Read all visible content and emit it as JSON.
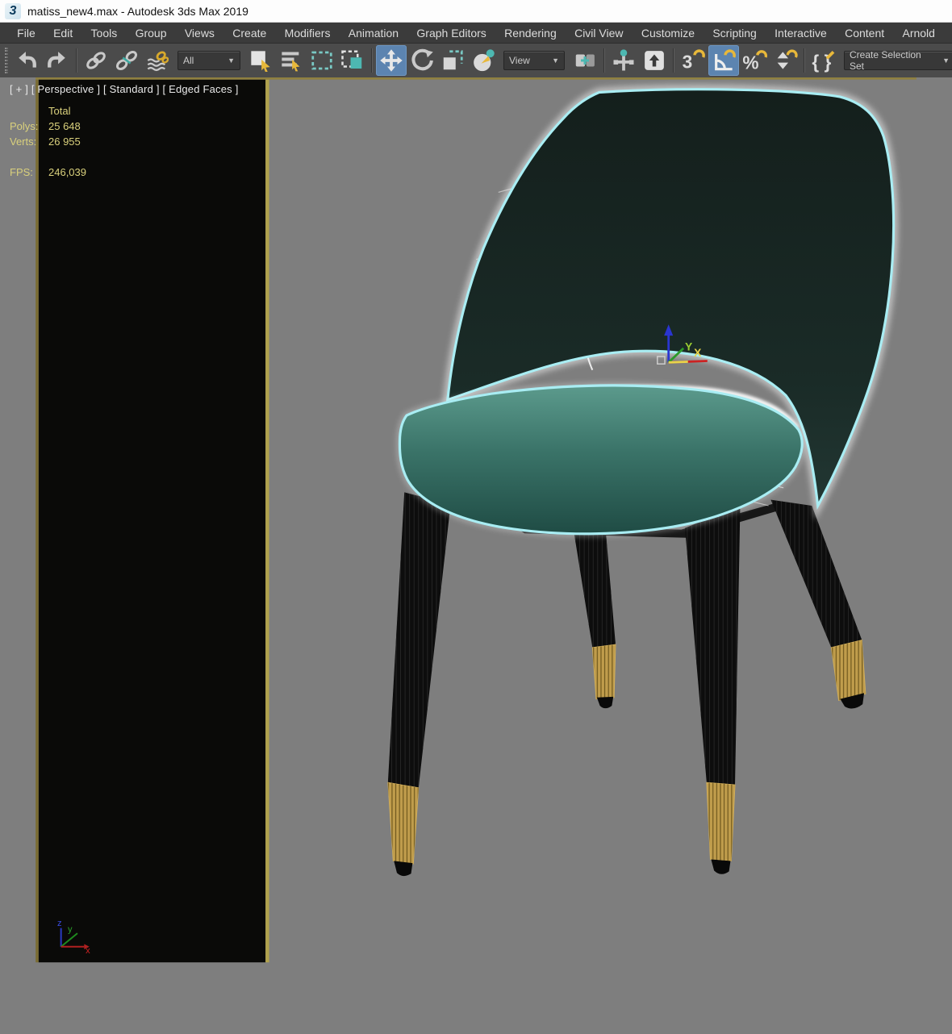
{
  "window": {
    "title": "matiss_new4.max - Autodesk 3ds Max 2019",
    "app_icon_glyph": "3"
  },
  "menu": {
    "items": [
      {
        "label": "File"
      },
      {
        "label": "Edit"
      },
      {
        "label": "Tools"
      },
      {
        "label": "Group"
      },
      {
        "label": "Views"
      },
      {
        "label": "Create"
      },
      {
        "label": "Modifiers"
      },
      {
        "label": "Animation"
      },
      {
        "label": "Graph Editors"
      },
      {
        "label": "Rendering"
      },
      {
        "label": "Civil View"
      },
      {
        "label": "Customize"
      },
      {
        "label": "Scripting"
      },
      {
        "label": "Interactive"
      },
      {
        "label": "Content"
      },
      {
        "label": "Arnold"
      }
    ]
  },
  "toolbar": {
    "selection_filter_value": "All",
    "coord_system_value": "View",
    "selection_set_placeholder": "Create Selection Set",
    "dropdown_arrow": "▼",
    "active_buttons": [
      "select-and-move",
      "angle-snap-toggle"
    ],
    "buttons": [
      {
        "name": "undo"
      },
      {
        "name": "redo"
      },
      {
        "name": "select-and-link"
      },
      {
        "name": "unlink-selection"
      },
      {
        "name": "bind-to-space-warp"
      },
      {
        "name": "selection-filter-dropdown"
      },
      {
        "name": "select-object"
      },
      {
        "name": "select-by-name"
      },
      {
        "name": "rectangular-selection-region"
      },
      {
        "name": "window-crossing-toggle"
      },
      {
        "name": "select-and-move"
      },
      {
        "name": "select-and-rotate"
      },
      {
        "name": "select-and-uniform-scale"
      },
      {
        "name": "select-and-place"
      },
      {
        "name": "reference-coordinate-system"
      },
      {
        "name": "use-pivot-point-center"
      },
      {
        "name": "select-and-manipulate"
      },
      {
        "name": "keyboard-shortcut-override-toggle"
      },
      {
        "name": "snaps-toggle-3d"
      },
      {
        "name": "angle-snap-toggle"
      },
      {
        "name": "percent-snap-toggle"
      },
      {
        "name": "spinner-snap-toggle"
      },
      {
        "name": "edit-named-selection-sets"
      },
      {
        "name": "create-selection-set-dropdown"
      }
    ],
    "snap_glyphs": {
      "snap3d": "3",
      "percent": "%",
      "named_sets": "{ }"
    }
  },
  "viewport": {
    "label_text": "[ + ] [ Perspective ] [ Standard ] [ Edged Faces ]",
    "stats": {
      "header": "Total",
      "polys_label": "Polys:",
      "polys_value": "25 648",
      "verts_label": "Verts:",
      "verts_value": "26 955",
      "fps_label": "FPS:",
      "fps_value": "246,039"
    },
    "transform_gizmo_labels": {
      "x": "X",
      "y": "Y"
    },
    "world_axis_labels": {
      "x": "x",
      "y": "y",
      "z": "z"
    },
    "colors": {
      "background": "#7e7e7e",
      "panel_black": "#0a0a08",
      "active_border": "#b1a24d",
      "edge_border": "#7a6c33",
      "selection_outline_cyan": "#a9edf3",
      "upholstery_teal": "#3a7368",
      "wireframe_white": "#eef2f0",
      "legs_black": "#0d0d0d",
      "brass_gold": "#c09d4c",
      "stats_text": "#d9d07c",
      "active_button_blue": "#5c84b0"
    }
  }
}
